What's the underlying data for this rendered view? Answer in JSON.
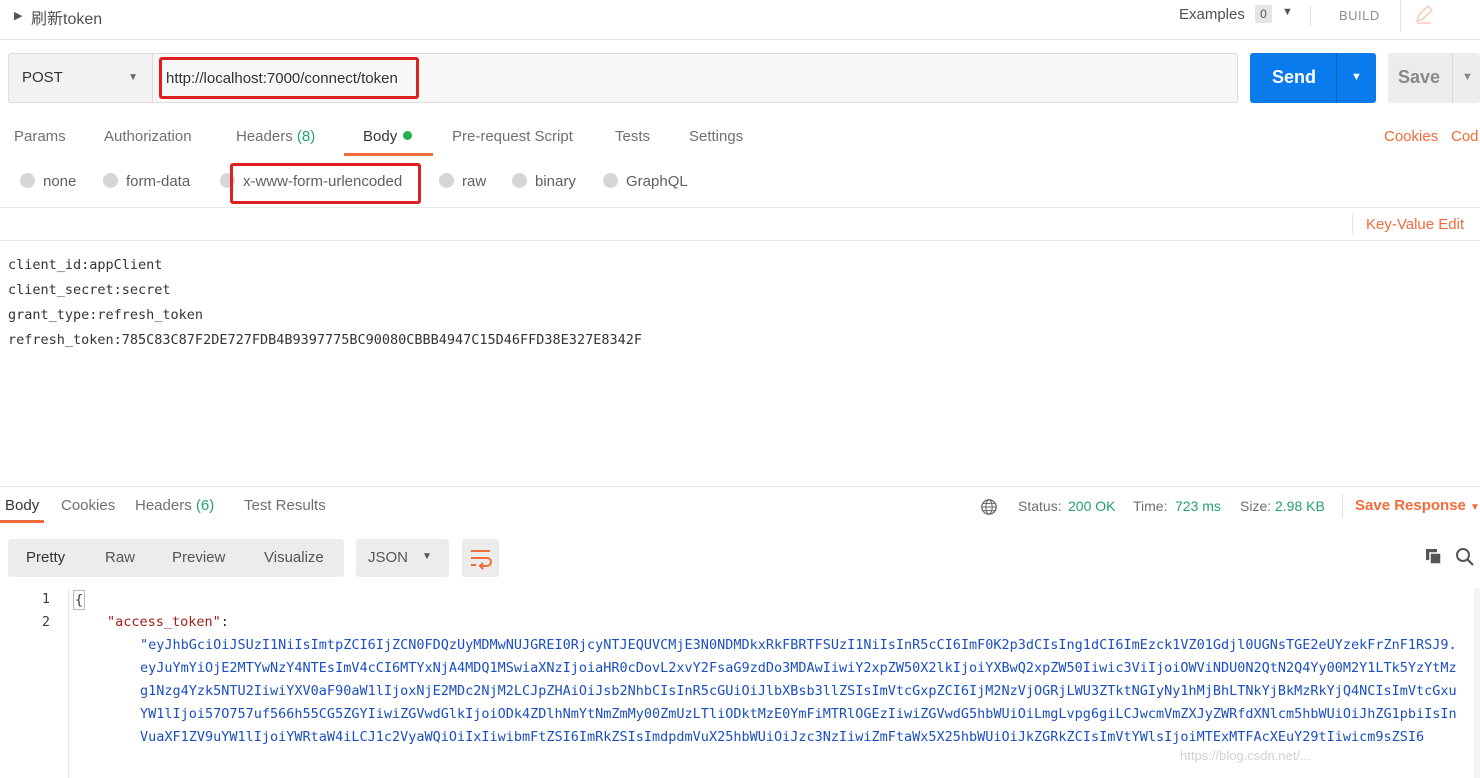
{
  "header": {
    "title": "刷新token",
    "examples_label": "Examples",
    "examples_count": "0",
    "build_label": "BUILD"
  },
  "request": {
    "method": "POST",
    "url": "http://localhost:7000/connect/token",
    "send_label": "Send",
    "save_label": "Save"
  },
  "request_tabs": {
    "params": "Params",
    "authorization": "Authorization",
    "headers": "Headers",
    "headers_count": "(8)",
    "body": "Body",
    "prerequest": "Pre-request Script",
    "tests": "Tests",
    "settings": "Settings",
    "cookies": "Cookies",
    "code": "Cod"
  },
  "body_types": {
    "none": "none",
    "form_data": "form-data",
    "urlencoded": "x-www-form-urlencoded",
    "raw": "raw",
    "binary": "binary",
    "graphql": "GraphQL"
  },
  "bulk_edit": {
    "toggle_label": "Key-Value Edit",
    "lines": [
      "client_id:appClient",
      "client_secret:secret",
      "grant_type:refresh_token",
      "refresh_token:785C83C87F2DE727FDB4B9397775BC90080CBBB4947C15D46FFD38E327E8342F"
    ]
  },
  "response_tabs": {
    "body": "Body",
    "cookies": "Cookies",
    "headers": "Headers",
    "headers_count": "(6)",
    "test_results": "Test Results"
  },
  "response_meta": {
    "status_label": "Status:",
    "status_value": "200 OK",
    "time_label": "Time:",
    "time_value": "723 ms",
    "size_label": "Size:",
    "size_value": "2.98 KB",
    "save_response": "Save Response"
  },
  "view_modes": {
    "pretty": "Pretty",
    "raw": "Raw",
    "preview": "Preview",
    "visualize": "Visualize",
    "format": "JSON"
  },
  "code": {
    "line1_num": "1",
    "line2_num": "2",
    "open_brace": "{",
    "key": "\"access_token\"",
    "colon": ":",
    "token_lines": "\"eyJhbGciOiJSUzI1NiIsImtpZCI6IjZCN0FDQzUyMDMwNUJGREI0RjcyNTJEQUVCMjE3N0NDMDkxRkFBRTFSUzI1NiIsInR5cCI6ImF0K2p3dCIsIng1dCI6ImEzck1VZ01Gdjl0UGNsTGE2eUYzekFrZnF1RSJ9.\neyJuYmYiOjE2MTYwNzY4NTEsImV4cCI6MTYxNjA4MDQ1MSwiaXNzIjoiaHR0cDovL2xvY2FsaG9zdDo3MDAwIiwiY2xpZW50X2lkIjoiYXBwQ2xpZW50Iiwic3ViIjoiOWViNDU0N2QtN2Q4Yy00M2Y1LTk5YzYtMzg1Nzg4Yzk5NTU2IiwiYXV0aF90aW1lIjoxNjE2MDc2NjM2LCJpZHAiOiJsb2NhbCIsInR5cGUiOiJlbXBsb3llZSIsImVtcGxpZCI6IjM2NzVjOGRjLWU3ZTktNGIyNy1hMjBhLTNkYjBkMzRkYjQ4NCIsImVtcGxuYW1lIjoi57O757uf566h55CG5ZGYIiwiZGVwdGlkIjoiODk4ZDlhNmYtNmZmMy00ZmUzLTliODktMzE0YmFiMTRlOGEzIiwiZGVwdG5hbWUiOiLmgLvpg6giLCJwcmVmZXJyZWRfdXNlcm5hbWUiOiJhZG1pbiIsInVuaXF1ZV9uYW1lIjoiYWRtaW4iLCJ1c2VyaWQiOiIxIiwibmFtZSI6ImRkZSIsImdpdmVuX25hbWUiOiJzc3NzIiwiZmFtaWx5X25hbWUiOiJkZGRkZCIsImVtYWlsIjoiMTExMTFAcXEuY29tIiwicm9sZSI6"
  },
  "watermark": "https://blog.csdn.net/...",
  "colors": {
    "accent_orange": "#f26b3a",
    "send_blue": "#097bed",
    "status_green": "#26a269",
    "highlight_red": "#e02020"
  }
}
